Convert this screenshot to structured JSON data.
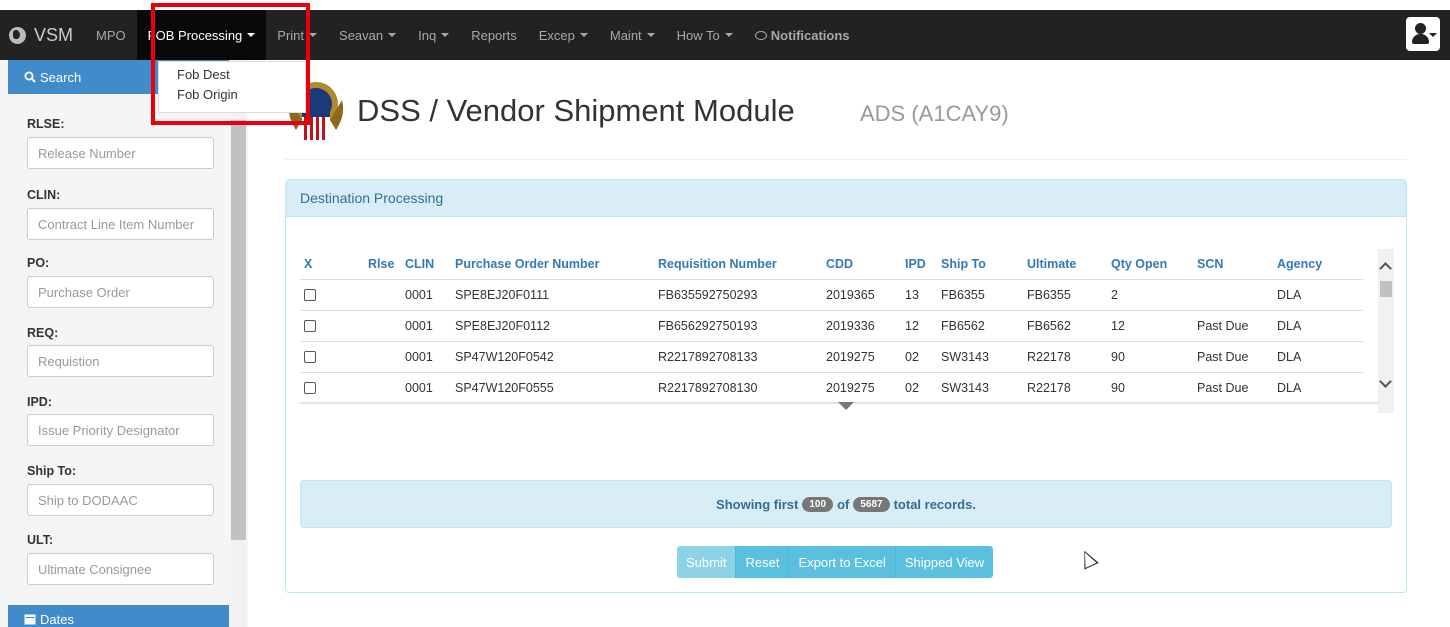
{
  "nav": {
    "brand": "VSM",
    "items": [
      {
        "label": "MPO",
        "dropdown": false
      },
      {
        "label": "FOB Processing",
        "dropdown": true
      },
      {
        "label": "Print",
        "dropdown": true
      },
      {
        "label": "Seavan",
        "dropdown": true
      },
      {
        "label": "Inq",
        "dropdown": true
      },
      {
        "label": "Reports",
        "dropdown": false
      },
      {
        "label": "Excep",
        "dropdown": true
      },
      {
        "label": "Maint",
        "dropdown": true
      },
      {
        "label": "How To",
        "dropdown": true
      },
      {
        "label": "Notifications",
        "dropdown": false
      }
    ],
    "fob_menu": [
      "Fob Dest",
      "Fob Origin"
    ]
  },
  "sidebar": {
    "search_label": "Search",
    "dates_label": "Dates",
    "fields": [
      {
        "label": "RLSE:",
        "placeholder": "Release Number"
      },
      {
        "label": "CLIN:",
        "placeholder": "Contract Line Item Number"
      },
      {
        "label": "PO:",
        "placeholder": "Purchase Order"
      },
      {
        "label": "REQ:",
        "placeholder": "Requistion"
      },
      {
        "label": "IPD:",
        "placeholder": "Issue Priority Designator"
      },
      {
        "label": "Ship To:",
        "placeholder": "Ship to DODAAC"
      },
      {
        "label": "ULT:",
        "placeholder": "Ultimate Consignee"
      }
    ]
  },
  "header": {
    "title": "DSS / Vendor Shipment Module",
    "subtitle": "ADS (A1CAY9)"
  },
  "panel": {
    "title": "Destination Processing",
    "columns": [
      "X",
      "Rlse",
      "CLIN",
      "Purchase Order Number",
      "Requisition Number",
      "CDD",
      "IPD",
      "Ship To",
      "Ultimate",
      "Qty Open",
      "SCN",
      "Agency"
    ],
    "rows": [
      {
        "rlse": "",
        "clin": "0001",
        "po": "SPE8EJ20F0111",
        "req": "FB635592750293",
        "cdd": "2019365",
        "ipd": "13",
        "ship_to": "FB6355",
        "ultimate": "FB6355",
        "qty": "2",
        "scn": "",
        "agency": "DLA"
      },
      {
        "rlse": "",
        "clin": "0001",
        "po": "SPE8EJ20F0112",
        "req": "FB656292750193",
        "cdd": "2019336",
        "ipd": "12",
        "ship_to": "FB6562",
        "ultimate": "FB6562",
        "qty": "12",
        "scn": "Past Due",
        "agency": "DLA"
      },
      {
        "rlse": "",
        "clin": "0001",
        "po": "SP47W120F0542",
        "req": "R2217892708133",
        "cdd": "2019275",
        "ipd": "02",
        "ship_to": "SW3143",
        "ultimate": "R22178",
        "qty": "90",
        "scn": "Past Due",
        "agency": "DLA"
      },
      {
        "rlse": "",
        "clin": "0001",
        "po": "SP47W120F0555",
        "req": "R2217892708130",
        "cdd": "2019275",
        "ipd": "02",
        "ship_to": "SW3143",
        "ultimate": "R22178",
        "qty": "90",
        "scn": "Past Due",
        "agency": "DLA"
      }
    ],
    "info": {
      "prefix": "Showing first",
      "shown": "100",
      "of": "of",
      "total": "5687",
      "suffix": "total records."
    },
    "buttons": [
      "Submit",
      "Reset",
      "Export to Excel",
      "Shipped View"
    ]
  }
}
